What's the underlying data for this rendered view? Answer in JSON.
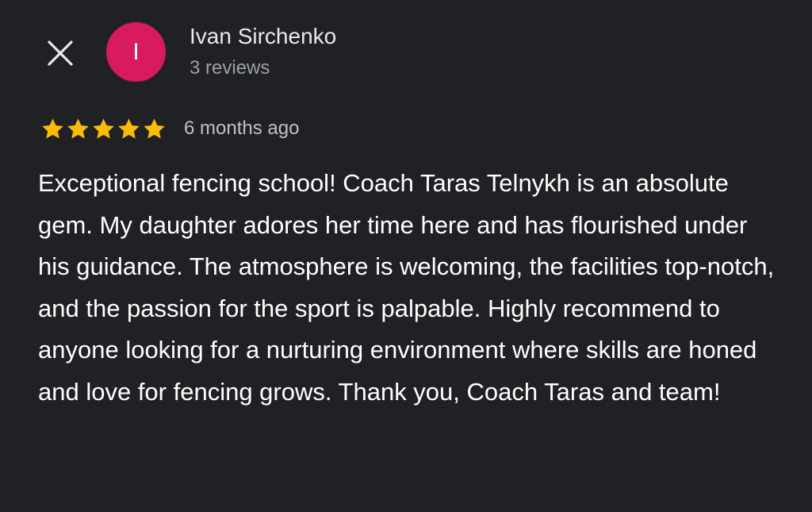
{
  "reviewer": {
    "name": "Ivan Sirchenko",
    "initial": "I",
    "review_count": "3 reviews",
    "avatar_color": "#d81b60"
  },
  "close_icon": "close-icon",
  "review": {
    "rating": 5,
    "max_rating": 5,
    "star_color": "#fbbc04",
    "time_ago": "6 months ago",
    "text": "Exceptional fencing school! Coach Taras Telnykh is an absolute gem. My daughter adores her time here and has flourished under his guidance. The atmosphere is welcoming, the facilities top-notch, and the passion for the sport is palpable. Highly recommend to anyone looking for a nurturing environment where skills are honed and love for fencing grows. Thank you, Coach Taras and team!"
  }
}
